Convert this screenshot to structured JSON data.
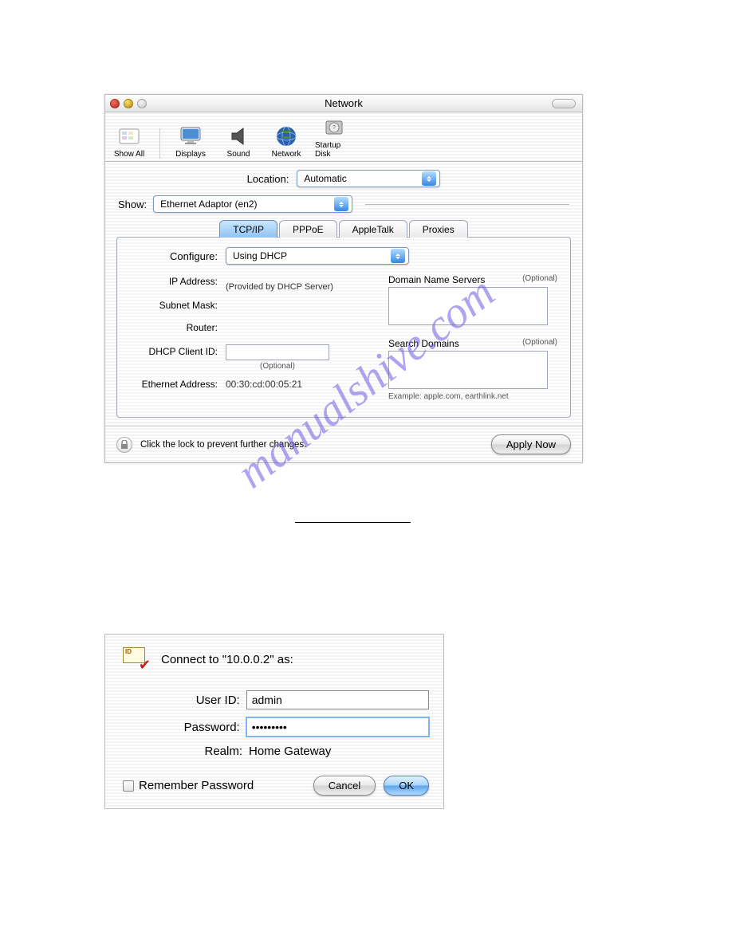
{
  "watermark": "manualshive.com",
  "window1": {
    "title": "Network",
    "toolbar": {
      "show_all": "Show All",
      "displays": "Displays",
      "sound": "Sound",
      "network": "Network",
      "startup_disk": "Startup Disk"
    },
    "location_label": "Location:",
    "location_value": "Automatic",
    "show_label": "Show:",
    "show_value": "Ethernet Adaptor (en2)",
    "tabs": {
      "tcpip": "TCP/IP",
      "pppoe": "PPPoE",
      "appletalk": "AppleTalk",
      "proxies": "Proxies"
    },
    "configure_label": "Configure:",
    "configure_value": "Using DHCP",
    "ip_label": "IP Address:",
    "ip_note": "(Provided by DHCP Server)",
    "subnet_label": "Subnet Mask:",
    "router_label": "Router:",
    "dhcp_client_label": "DHCP Client ID:",
    "dhcp_client_opt": "(Optional)",
    "eth_addr_label": "Ethernet Address:",
    "eth_addr_value": "00:30:cd:00:05:21",
    "dns_label": "Domain Name Servers",
    "dns_opt": "(Optional)",
    "search_label": "Search Domains",
    "search_opt": "(Optional)",
    "example": "Example: apple.com, earthlink.net",
    "lock_text": "Click the lock to prevent further changes.",
    "apply_label": "Apply Now"
  },
  "window2": {
    "heading": "Connect to \"10.0.0.2\" as:",
    "userid_label": "User ID:",
    "userid_value": "admin",
    "password_label": "Password:",
    "password_value": "•••••••••",
    "realm_label": "Realm:",
    "realm_value": "Home Gateway",
    "remember": "Remember Password",
    "cancel": "Cancel",
    "ok": "OK"
  }
}
